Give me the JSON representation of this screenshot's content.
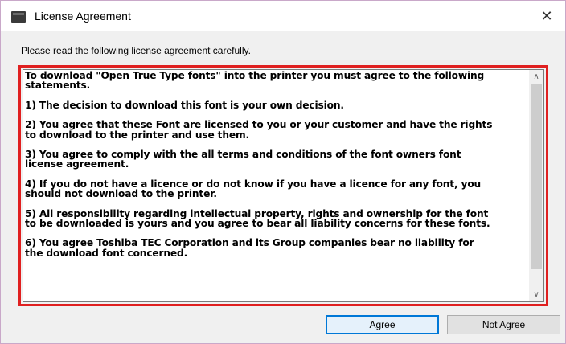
{
  "window": {
    "title": "License Agreement",
    "close_glyph": "✕"
  },
  "instruction": "Please read the following license agreement carefully.",
  "license_text": {
    "paragraphs": [
      "To download \"Open True Type fonts\" into the printer you must agree to the following\nstatements.",
      "1) The decision to download this font is your own decision.",
      "2) You agree that these Font are licensed to you or your customer and have the rights\nto download to the printer and use them.",
      "3) You agree to comply with the all terms and conditions of the font owners font\nlicense agreement.",
      "4) If you do not have a licence or do not know if you have a licence for any font, you\nshould not download to the printer.",
      "5) All responsibility regarding intellectual property, rights and ownership for the font\nto be downloaded is yours and you agree to bear all liability concerns for these fonts.",
      "6) You agree Toshiba TEC Corporation and its Group companies bear no liability for\nthe download font concerned."
    ]
  },
  "scrollbar": {
    "up_arrow": "∧",
    "down_arrow": "∨"
  },
  "buttons": {
    "agree_label": "Agree",
    "not_agree_label": "Not Agree"
  },
  "colors": {
    "highlight_border": "#e02020",
    "focus_border": "#0078d7"
  }
}
